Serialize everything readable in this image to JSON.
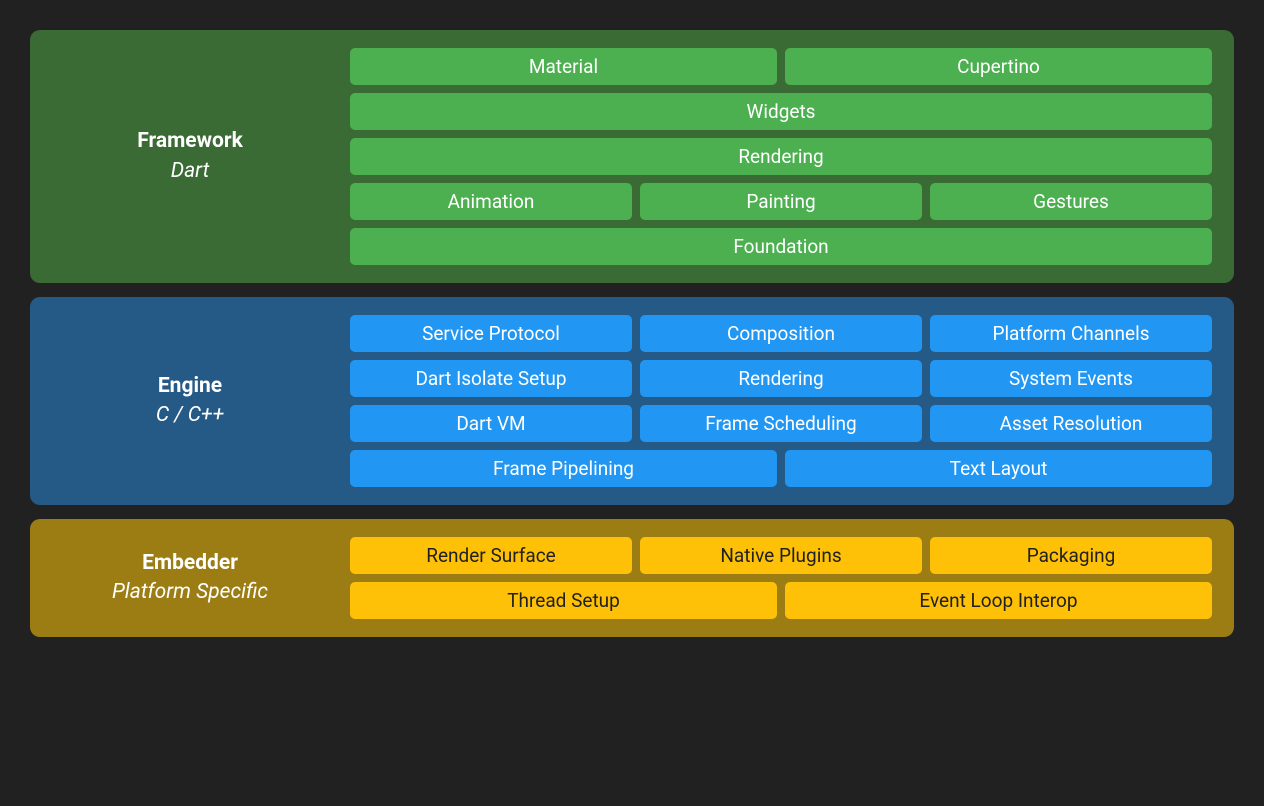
{
  "framework": {
    "title": "Framework",
    "subtitle": "Dart",
    "rows": [
      {
        "cells": [
          "Material",
          "Cupertino"
        ]
      },
      {
        "cells": [
          "Widgets"
        ]
      },
      {
        "cells": [
          "Rendering"
        ]
      },
      {
        "cells": [
          "Animation",
          "Painting",
          "Gestures"
        ]
      },
      {
        "cells": [
          "Foundation"
        ]
      }
    ]
  },
  "engine": {
    "title": "Engine",
    "subtitle": "C / C++",
    "rows": [
      {
        "cells": [
          "Service Protocol",
          "Composition",
          "Platform Channels"
        ]
      },
      {
        "cells": [
          "Dart Isolate Setup",
          "Rendering",
          "System Events"
        ]
      },
      {
        "cells": [
          "Dart VM",
          "Frame Scheduling",
          "Asset Resolution"
        ]
      },
      {
        "cells": [
          "Frame Pipelining",
          "Text Layout"
        ]
      }
    ]
  },
  "embedder": {
    "title": "Embedder",
    "subtitle": "Platform Specific",
    "rows": [
      {
        "cells": [
          "Render Surface",
          "Native Plugins",
          "Packaging"
        ]
      },
      {
        "cells": [
          "Thread Setup",
          "Event Loop Interop"
        ]
      }
    ]
  }
}
